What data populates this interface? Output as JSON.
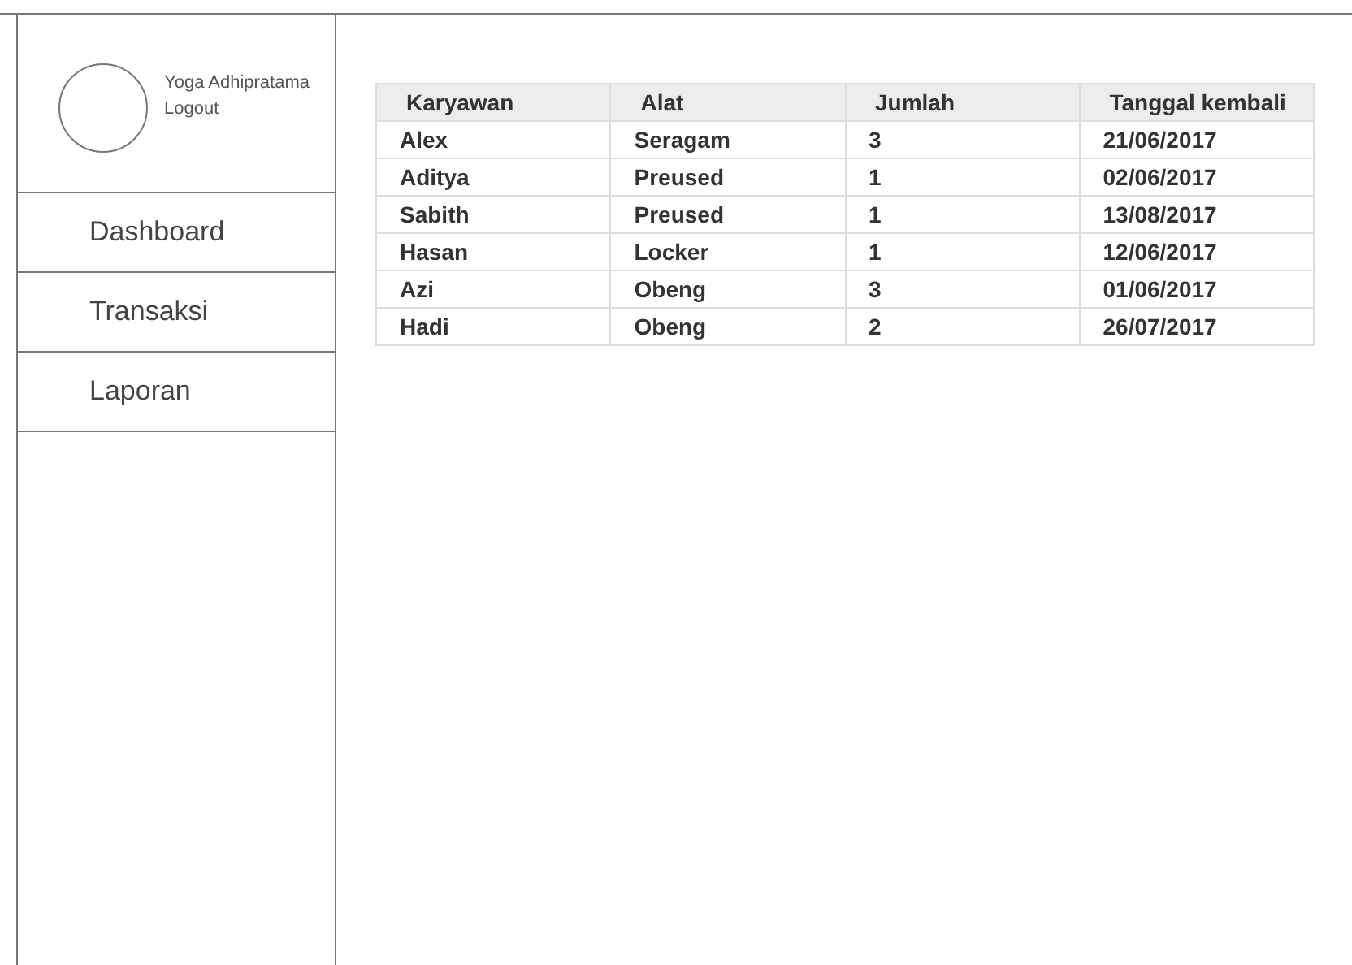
{
  "user": {
    "name": "Yoga Adhipratama",
    "logout": "Logout"
  },
  "nav": [
    {
      "label": "Dashboard"
    },
    {
      "label": "Transaksi"
    },
    {
      "label": "Laporan"
    }
  ],
  "table": {
    "columns": [
      "Karyawan",
      "Alat",
      "Jumlah",
      "Tanggal kembali"
    ],
    "rows": [
      [
        "Alex",
        "Seragam",
        "3",
        "21/06/2017"
      ],
      [
        "Aditya",
        "Preused",
        "1",
        "02/06/2017"
      ],
      [
        "Sabith",
        "Preused",
        "1",
        "13/08/2017"
      ],
      [
        "Hasan",
        "Locker",
        "1",
        "12/06/2017"
      ],
      [
        "Azi",
        "Obeng",
        "3",
        "01/06/2017"
      ],
      [
        "Hadi",
        "Obeng",
        "2",
        "26/07/2017"
      ]
    ]
  }
}
